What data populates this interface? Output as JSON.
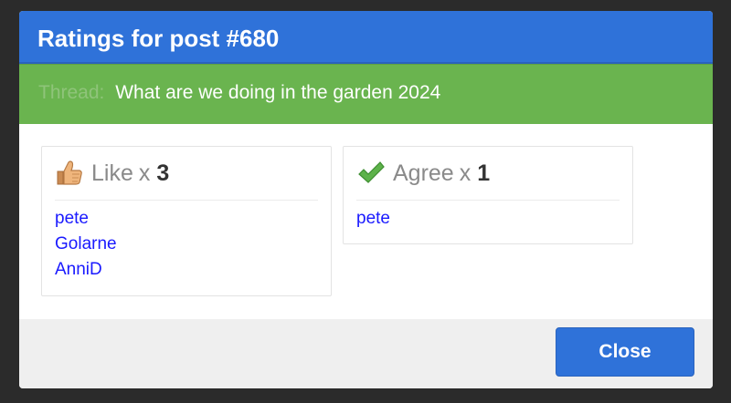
{
  "modal": {
    "title": "Ratings for post #680"
  },
  "thread": {
    "label": "Thread:",
    "title": "What are we doing in the garden 2024"
  },
  "ratings": [
    {
      "icon": "thumbs-up-icon",
      "name": "Like",
      "x": "x",
      "count": "3",
      "users": [
        "pete",
        "Golarne",
        "AnniD"
      ]
    },
    {
      "icon": "checkmark-icon",
      "name": "Agree",
      "x": "x",
      "count": "1",
      "users": [
        "pete"
      ]
    }
  ],
  "footer": {
    "close_label": "Close"
  },
  "colors": {
    "header_bg": "#2f72d9",
    "thread_bg": "#6ab44f",
    "link": "#1a1aff",
    "button_bg": "#2f72d9"
  }
}
